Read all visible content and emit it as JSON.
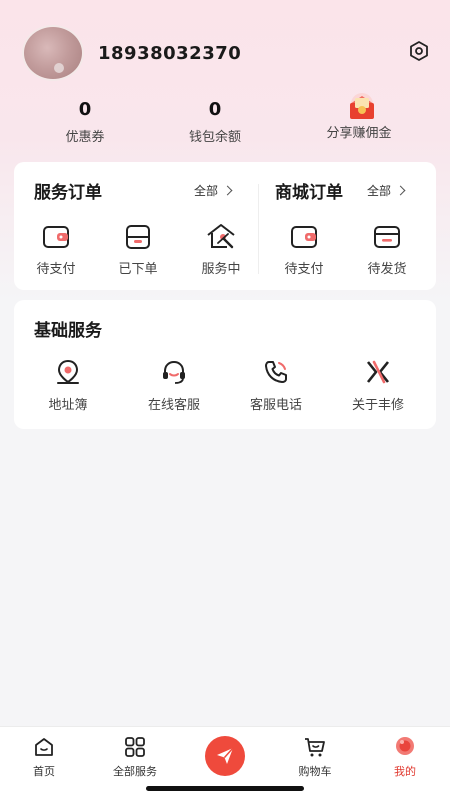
{
  "profile": {
    "phone": "18938032370"
  },
  "stats": [
    {
      "value": "0",
      "label": "优惠券"
    },
    {
      "value": "0",
      "label": "钱包余额"
    },
    {
      "label": "分享赚佣金"
    }
  ],
  "service_orders": {
    "title": "服务订单",
    "all_label": "全部",
    "items": [
      {
        "label": "待支付",
        "icon": "wallet-icon"
      },
      {
        "label": "已下单",
        "icon": "order-placed-icon"
      },
      {
        "label": "服务中",
        "icon": "house-tools-icon"
      }
    ]
  },
  "mall_orders": {
    "title": "商城订单",
    "all_label": "全部",
    "items": [
      {
        "label": "待支付",
        "icon": "wallet-icon"
      },
      {
        "label": "待发货",
        "icon": "pending-shipment-icon"
      }
    ]
  },
  "basic_services": {
    "title": "基础服务",
    "items": [
      {
        "label": "地址簿",
        "icon": "location-pin-icon"
      },
      {
        "label": "在线客服",
        "icon": "headset-icon"
      },
      {
        "label": "客服电话",
        "icon": "phone-icon"
      },
      {
        "label": "关于丰修",
        "icon": "brand-logo-icon"
      }
    ]
  },
  "tabbar": {
    "items": [
      {
        "label": "首页",
        "icon": "home-icon"
      },
      {
        "label": "全部服务",
        "icon": "grid-icon"
      },
      {
        "label": "",
        "icon": "send-icon"
      },
      {
        "label": "购物车",
        "icon": "cart-icon"
      },
      {
        "label": "我的",
        "icon": "profile-icon",
        "active": true
      }
    ]
  },
  "colors": {
    "accent": "#e0392f",
    "header_gradient_top": "#fbe4ea",
    "background": "#f5f5f7"
  }
}
